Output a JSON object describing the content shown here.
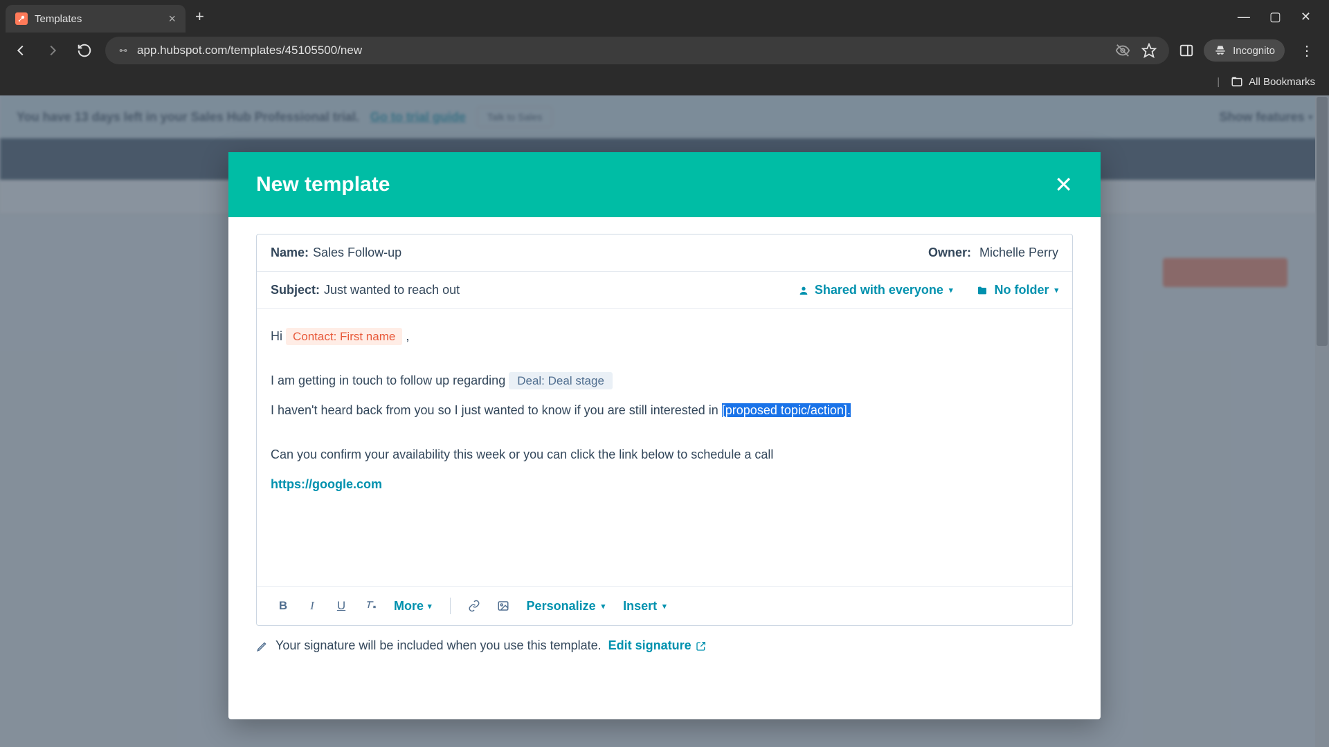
{
  "browser": {
    "tab_title": "Templates",
    "url": "app.hubspot.com/templates/45105500/new",
    "incognito_label": "Incognito",
    "bookmarks_label": "All Bookmarks"
  },
  "trial": {
    "text": "You have 13 days left in your Sales Hub Professional trial.",
    "guide_link": "Go to trial guide",
    "talk_button": "Talk to Sales",
    "show_features": "Show features"
  },
  "modal": {
    "title": "New template",
    "name_label": "Name:",
    "name_value": "Sales Follow-up",
    "owner_label": "Owner:",
    "owner_value": "Michelle Perry",
    "subject_label": "Subject:",
    "subject_value": "Just wanted to reach out",
    "shared_label": "Shared with everyone",
    "folder_label": "No folder"
  },
  "editor": {
    "greeting_prefix": "Hi ",
    "contact_token": "Contact: First name",
    "greeting_suffix": " ,",
    "line2_prefix": "I am getting in touch to follow up regarding ",
    "deal_token": "Deal: Deal stage",
    "line3_prefix": "I haven't heard back from you so I just wanted to know if you are still interested in ",
    "selected_placeholder": "[proposed topic/action].",
    "line4": "Can you confirm your availability this week or you can click the link below to schedule a call",
    "link": "https://google.com"
  },
  "toolbar": {
    "more": "More",
    "personalize": "Personalize",
    "insert": "Insert"
  },
  "signature": {
    "note": "Your signature will be included when you use this template.",
    "edit": "Edit signature"
  }
}
